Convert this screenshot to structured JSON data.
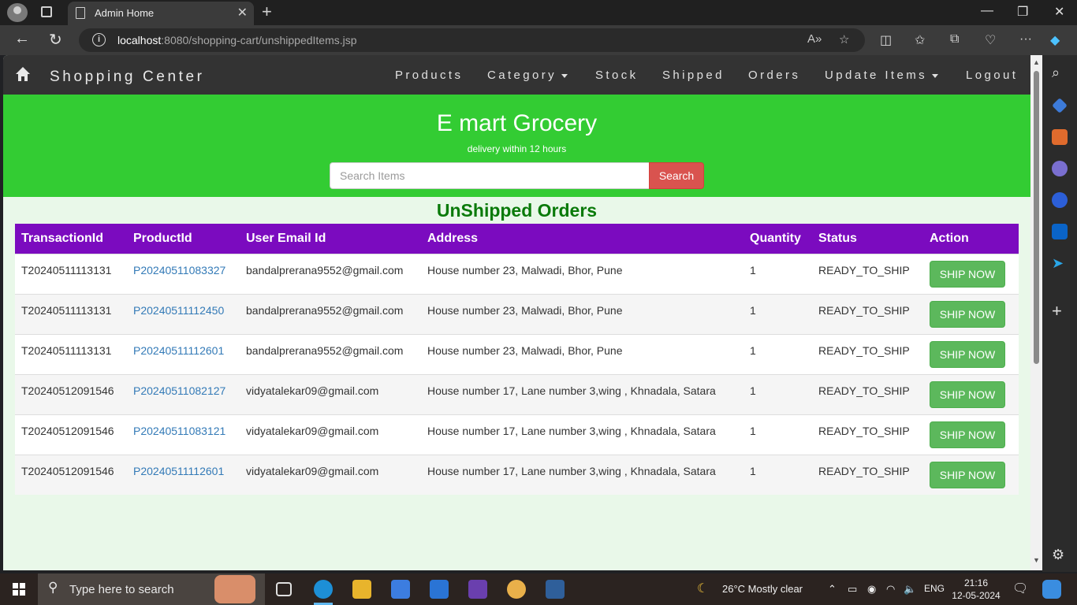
{
  "browser": {
    "tab_title": "Admin Home",
    "url_host": "localhost",
    "url_rest": ":8080/shopping-cart/unshippedItems.jsp"
  },
  "navbar": {
    "brand": "Shopping Center",
    "links": [
      "Products",
      "Category",
      "Stock",
      "Shipped",
      "Orders",
      "Update Items",
      "Logout"
    ]
  },
  "jumbotron": {
    "title": "E mart Grocery",
    "subtitle": "delivery within 12 hours",
    "search_placeholder": "Search Items",
    "search_button": "Search"
  },
  "page": {
    "heading": "UnShipped Orders"
  },
  "table": {
    "headers": [
      "TransactionId",
      "ProductId",
      "User Email Id",
      "Address",
      "Quantity",
      "Status",
      "Action"
    ],
    "rows": [
      {
        "transaction_id": "T20240511113131",
        "product_id": "P20240511083327",
        "email": "bandalprerana9552@gmail.com",
        "address": "House number 23, Malwadi, Bhor, Pune",
        "quantity": "1",
        "status": "READY_TO_SHIP",
        "action": "SHIP NOW"
      },
      {
        "transaction_id": "T20240511113131",
        "product_id": "P20240511112450",
        "email": "bandalprerana9552@gmail.com",
        "address": "House number 23, Malwadi, Bhor, Pune",
        "quantity": "1",
        "status": "READY_TO_SHIP",
        "action": "SHIP NOW"
      },
      {
        "transaction_id": "T20240511113131",
        "product_id": "P20240511112601",
        "email": "bandalprerana9552@gmail.com",
        "address": "House number 23, Malwadi, Bhor, Pune",
        "quantity": "1",
        "status": "READY_TO_SHIP",
        "action": "SHIP NOW"
      },
      {
        "transaction_id": "T20240512091546",
        "product_id": "P20240511082127",
        "email": "vidyatalekar09@gmail.com",
        "address": "House number 17, Lane number 3,wing , Khnadala, Satara",
        "quantity": "1",
        "status": "READY_TO_SHIP",
        "action": "SHIP NOW"
      },
      {
        "transaction_id": "T20240512091546",
        "product_id": "P20240511083121",
        "email": "vidyatalekar09@gmail.com",
        "address": "House number 17, Lane number 3,wing , Khnadala, Satara",
        "quantity": "1",
        "status": "READY_TO_SHIP",
        "action": "SHIP NOW"
      },
      {
        "transaction_id": "T20240512091546",
        "product_id": "P20240511112601",
        "email": "vidyatalekar09@gmail.com",
        "address": "House number 17, Lane number 3,wing , Khnadala, Satara",
        "quantity": "1",
        "status": "READY_TO_SHIP",
        "action": "SHIP NOW"
      }
    ]
  },
  "taskbar": {
    "search_placeholder": "Type here to search",
    "weather": "26°C  Mostly clear",
    "language": "ENG",
    "time": "21:16",
    "date": "12-05-2024"
  },
  "colors": {
    "navbar_bg": "#333333",
    "jumbotron_bg": "#33cc33",
    "table_header_bg": "#7b0bbf",
    "heading_color": "#0a7a0a",
    "search_button_bg": "#d9534f",
    "ship_button_bg": "#5cb85c"
  }
}
